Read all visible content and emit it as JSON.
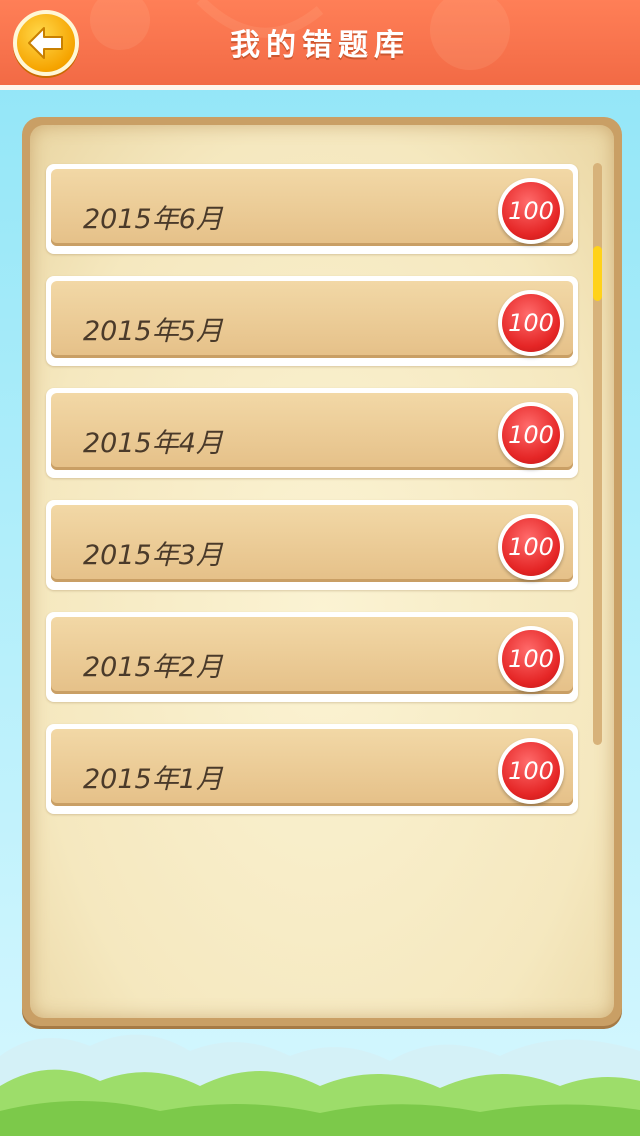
{
  "header": {
    "title": "我的错题库",
    "back_icon": "arrow-left-icon"
  },
  "items": [
    {
      "label": "2015年6月",
      "count": "100"
    },
    {
      "label": "2015年5月",
      "count": "100"
    },
    {
      "label": "2015年4月",
      "count": "100"
    },
    {
      "label": "2015年3月",
      "count": "100"
    },
    {
      "label": "2015年2月",
      "count": "100"
    },
    {
      "label": "2015年1月",
      "count": "100"
    }
  ],
  "colors": {
    "header": "#f26a45",
    "accent": "#ffd21a",
    "badge": "#e52626",
    "panel": "#c99f65"
  }
}
